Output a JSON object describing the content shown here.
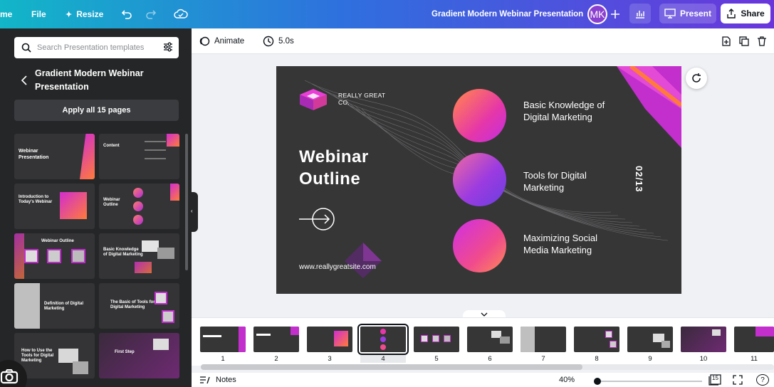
{
  "topbar": {
    "home_label": "me",
    "file_label": "File",
    "resize_label": "Resize",
    "doc_title": "Gradient Modern Webinar Presentation",
    "avatar_initials": "MK",
    "present_label": "Present",
    "share_label": "Share"
  },
  "sidebar": {
    "search_placeholder": "Search Presentation templates",
    "template_title": "Gradient Modern Webinar Presentation",
    "apply_label": "Apply all 15 pages",
    "thumbs": [
      {
        "title": "Webinar Presentation"
      },
      {
        "title": "Content"
      },
      {
        "title": "Introduction to Today's Webinar"
      },
      {
        "title": "Webinar Outline"
      },
      {
        "title": "Webinar Outline"
      },
      {
        "title": "Basic Knowledge of Digital Marketing"
      },
      {
        "title": "Definition of Digital Marketing"
      },
      {
        "title": "The Basic of Tools for Digital Marketing"
      },
      {
        "title": "How to Use the Tools for Digital Marketing"
      },
      {
        "title": "First Step"
      }
    ]
  },
  "toolbar": {
    "animate_label": "Animate",
    "duration_label": "5.0s"
  },
  "slide": {
    "logo_line1": "REALLY GREAT",
    "logo_line2": "CO.",
    "title_line1": "Webinar",
    "title_line2": "Outline",
    "url": "www.reallygreatsite.com",
    "page_no": "02/13",
    "topics": [
      "Basic Knowledge of Digital Marketing",
      "Tools for Digital Marketing",
      "Maximizing Social Media Marketing"
    ]
  },
  "filmstrip": {
    "pages": [
      "1",
      "2",
      "3",
      "4",
      "5",
      "6",
      "7",
      "8",
      "9",
      "10",
      "11"
    ],
    "selected": "4"
  },
  "bottombar": {
    "notes_label": "Notes",
    "zoom_label": "40%",
    "page_count": "15",
    "help_label": "?"
  },
  "colors": {
    "accent_gradient_start": "#12b6c8",
    "accent_gradient_end": "#6a36dc",
    "slide_bg": "#363637",
    "magenta": "#d22dd0"
  }
}
